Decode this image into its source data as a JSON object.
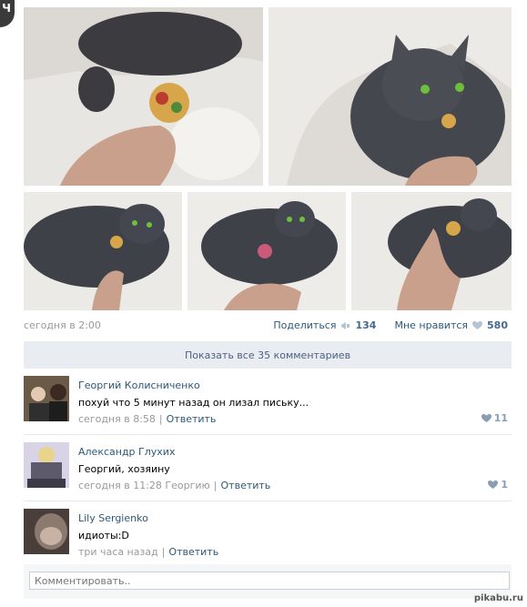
{
  "author_avatar_letter": "Ч",
  "post": {
    "date": "сегодня в 2:00",
    "share_label": "Поделиться",
    "share_count": "134",
    "like_label": "Мне нравится",
    "like_count": "580",
    "show_all_comments": "Показать все 35 комментариев"
  },
  "comments": [
    {
      "author": "Георгий Колисниченко",
      "text": "похуй что 5 минут назад он лизал письку...",
      "time": "сегодня в 8:58",
      "reply": "Ответить",
      "likes": "11"
    },
    {
      "author": "Александр Глухих",
      "text": "Георгий, хозяину",
      "time": "сегодня в 11:28 Георгию",
      "reply": "Ответить",
      "likes": "1"
    },
    {
      "author": "Lily Sergienko",
      "text": "идиоты:D",
      "time": "три часа назад",
      "reply": "Ответить",
      "likes": ""
    }
  ],
  "comment_input": {
    "placeholder": "Комментировать.."
  },
  "watermark": "pikabu.ru",
  "icons": {
    "share": "megaphone-icon",
    "like": "heart-icon"
  },
  "colors": {
    "link": "#2b587a",
    "muted": "#999999",
    "bar": "#e9edf1"
  }
}
